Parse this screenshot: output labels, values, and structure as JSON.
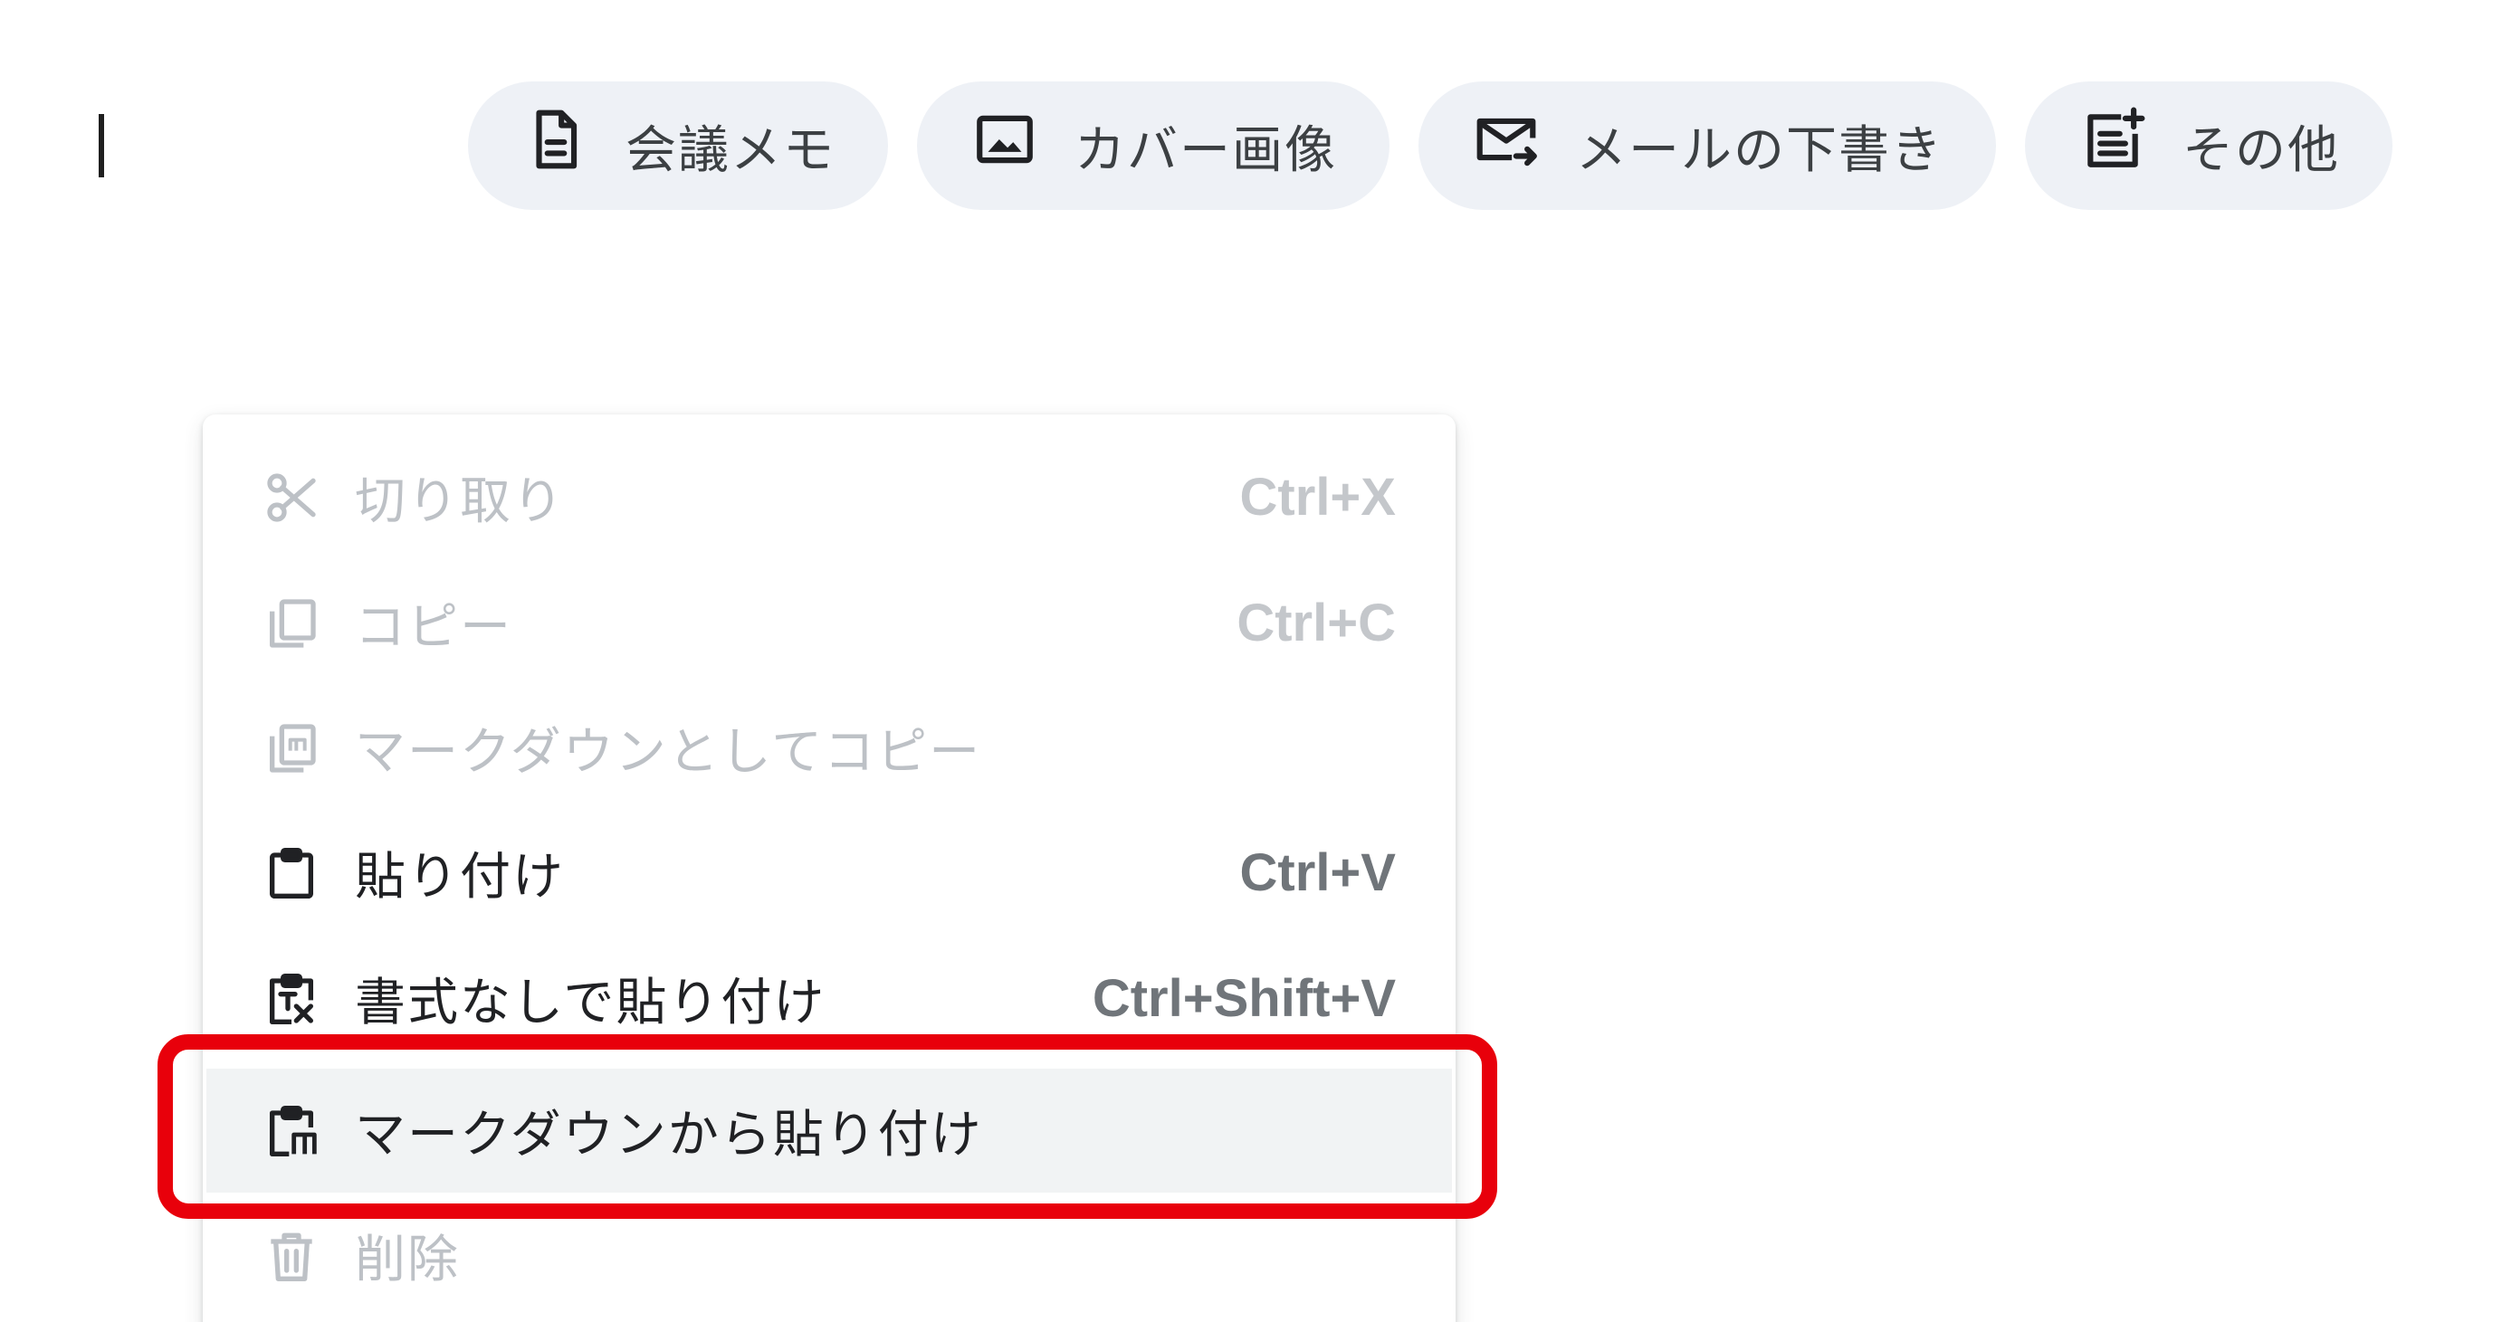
{
  "chips": [
    {
      "label": "会議メモ",
      "icon": "document-icon"
    },
    {
      "label": "カバー画像",
      "icon": "image-icon"
    },
    {
      "label": "メールの下書き",
      "icon": "email-send-icon"
    },
    {
      "label": "その他",
      "icon": "note-add-icon"
    }
  ],
  "menu": {
    "items": [
      {
        "label": "切り取り",
        "shortcut": "Ctrl+X",
        "icon": "scissors-icon",
        "enabled": false
      },
      {
        "label": "コピー",
        "shortcut": "Ctrl+C",
        "icon": "copy-icon",
        "enabled": false
      },
      {
        "label": "マークダウンとしてコピー",
        "shortcut": "",
        "icon": "copy-markdown-icon",
        "enabled": false
      },
      {
        "label": "貼り付け",
        "shortcut": "Ctrl+V",
        "icon": "clipboard-icon",
        "enabled": true
      },
      {
        "label": "書式なしで貼り付け",
        "shortcut": "Ctrl+Shift+V",
        "icon": "clipboard-clear-format-icon",
        "enabled": true
      },
      {
        "label": "マークダウンから貼り付け",
        "shortcut": "",
        "icon": "clipboard-markdown-icon",
        "enabled": true,
        "highlighted": true
      },
      {
        "label": "削除",
        "shortcut": "",
        "icon": "trash-icon",
        "enabled": false
      }
    ]
  },
  "colors": {
    "highlight_border": "#e8000b",
    "chip_bg": "#eef1f6",
    "hover_bg": "#f1f3f4"
  }
}
